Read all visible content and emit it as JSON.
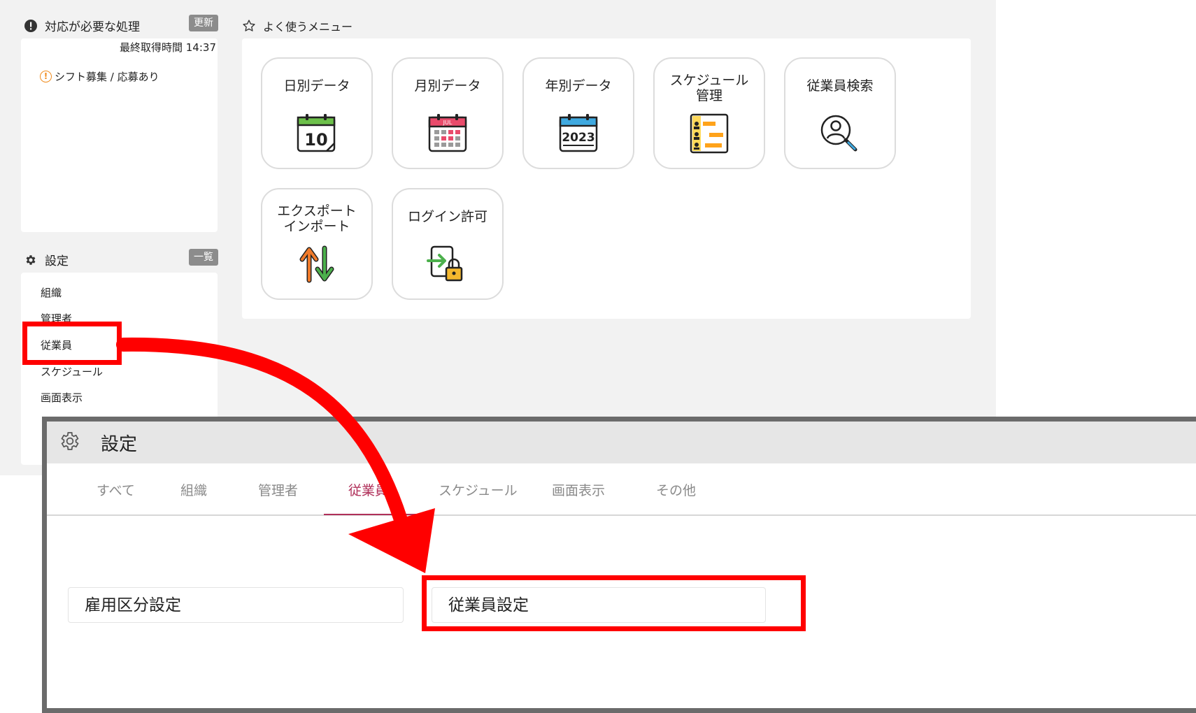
{
  "alerts": {
    "title": "対応が必要な処理",
    "refresh_label": "更新",
    "last_fetch": "最終取得時間 14:37",
    "item": "シフト募集 / 応募あり"
  },
  "favorites": {
    "title": "よく使うメニュー",
    "tiles": [
      {
        "label": "日別データ",
        "icon": "daily-calendar-icon"
      },
      {
        "label": "月別データ",
        "icon": "monthly-calendar-icon",
        "icon_text": "JUL"
      },
      {
        "label": "年別データ",
        "icon": "yearly-calendar-icon",
        "icon_text": "2023"
      },
      {
        "label": "スケジュール\n管理",
        "icon": "schedule-board-icon"
      },
      {
        "label": "従業員検索",
        "icon": "employee-search-icon"
      },
      {
        "label": "エクスポート\nインポート",
        "icon": "export-import-icon"
      },
      {
        "label": "ログイン許可",
        "icon": "login-lock-icon"
      }
    ],
    "daily_icon_text": "10"
  },
  "settings_panel": {
    "title": "設定",
    "list_label": "一覧",
    "items": [
      "組織",
      "管理者",
      "従業員",
      "スケジュール",
      "画面表示"
    ]
  },
  "settings_window": {
    "title": "設定",
    "tabs": [
      "すべて",
      "組織",
      "管理者",
      "従業員",
      "スケジュール",
      "画面表示",
      "その他"
    ],
    "active_tab": "従業員",
    "options": [
      "雇用区分設定",
      "従業員設定"
    ]
  },
  "colors": {
    "highlight": "#ff0000",
    "active_tab": "#b0305a",
    "chip": "#8c8c8c"
  }
}
